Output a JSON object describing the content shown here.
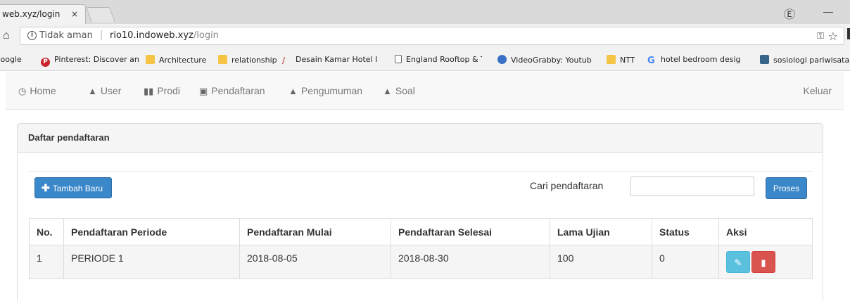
{
  "browser": {
    "tab_title": "web.xyz/login",
    "tab_close": "×",
    "security_label": "Tidak aman",
    "url_host": "rio10.indoweb.xyz",
    "url_path": "/login"
  },
  "bookmarks": [
    {
      "label": "Google",
      "icon": "none"
    },
    {
      "label": "Pinterest: Discover an",
      "icon": "pinterest-icon"
    },
    {
      "label": "Architecture",
      "icon": "folder-icon"
    },
    {
      "label": "relationship",
      "icon": "folder-icon"
    },
    {
      "label": "Desain Kamar Hotel I",
      "icon": "slash-icon"
    },
    {
      "label": "England Rooftop & T",
      "icon": "document-icon"
    },
    {
      "label": "VideoGrabby: Youtub",
      "icon": "videograbby-icon"
    },
    {
      "label": "NTT",
      "icon": "folder-icon"
    },
    {
      "label": "hotel bedroom desig",
      "icon": "google-icon"
    },
    {
      "label": "sosiologi pariwisata",
      "icon": "image-icon"
    }
  ],
  "nav": {
    "items": [
      {
        "label": "Home",
        "icon": "clock-icon"
      },
      {
        "label": "User",
        "icon": "user-icon"
      },
      {
        "label": "Prodi",
        "icon": "users-icon"
      },
      {
        "label": "Pendaftaran",
        "icon": "picture-icon"
      },
      {
        "label": "Pengumuman",
        "icon": "user-icon"
      },
      {
        "label": "Soal",
        "icon": "user-icon"
      }
    ],
    "logout": "Keluar"
  },
  "panel": {
    "title": "Daftar pendaftaran",
    "add_button": "Tambah Baru",
    "search_label": "Cari pendaftaran",
    "search_value": "",
    "process_button": "Proses"
  },
  "table": {
    "headers": [
      "No.",
      "Pendaftaran Periode",
      "Pendaftaran Mulai",
      "Pendaftaran Selesai",
      "Lama Ujian",
      "Status",
      "Aksi"
    ],
    "rows": [
      [
        "1",
        "PERIODE 1",
        "2018-08-05",
        "2018-08-30",
        "100",
        "0"
      ]
    ]
  },
  "colors": {
    "primary": "#3a87c9",
    "info": "#5bc0de",
    "danger": "#d9534f"
  }
}
